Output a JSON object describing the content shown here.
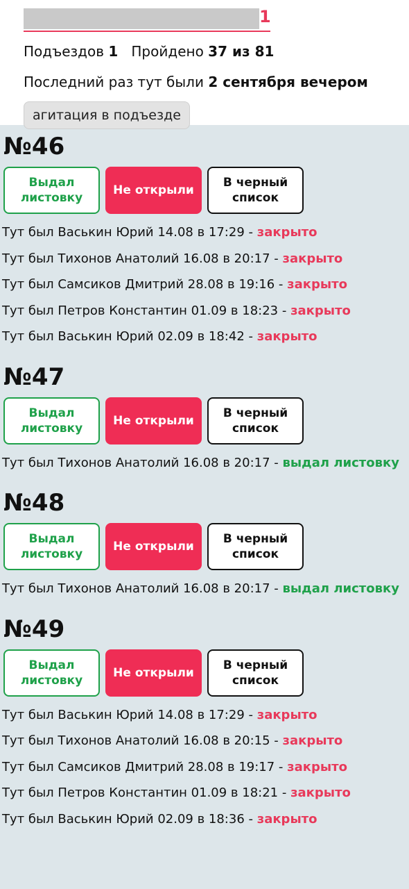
{
  "header": {
    "address_number": "1",
    "entrances_label": "Подъездов",
    "entrances_value": "1",
    "passed_label": "Пройдено",
    "passed_value": "37 из 81",
    "last_visit_label": "Последний раз тут были",
    "last_visit_value": "2 сентября вечером",
    "chip_label": "агитация в подъезде"
  },
  "buttons": {
    "leaflet": "Выдал листовку",
    "not_opened": "Не открыли",
    "blacklist": "В черный список"
  },
  "flats": [
    {
      "title": "№46",
      "visits": [
        {
          "text": "Тут был Васькин Юрий 14.08 в 17:29 -",
          "status": "закрыто",
          "type": "red"
        },
        {
          "text": "Тут был Тихонов Анатолий 16.08 в 20:17 -",
          "status": "закрыто",
          "type": "red"
        },
        {
          "text": "Тут был Самсиков Дмитрий 28.08 в 19:16 -",
          "status": "закрыто",
          "type": "red"
        },
        {
          "text": "Тут был Петров Константин 01.09 в 18:23 -",
          "status": "закрыто",
          "type": "red"
        },
        {
          "text": "Тут был Васькин Юрий 02.09 в 18:42 -",
          "status": "закрыто",
          "type": "red"
        }
      ]
    },
    {
      "title": "№47",
      "visits": [
        {
          "text": "Тут был Тихонов Анатолий 16.08 в 20:17 -",
          "status": "выдал листовку",
          "type": "green"
        }
      ]
    },
    {
      "title": "№48",
      "visits": [
        {
          "text": "Тут был Тихонов Анатолий 16.08 в 20:17 -",
          "status": "выдал листовку",
          "type": "green"
        }
      ]
    },
    {
      "title": "№49",
      "visits": [
        {
          "text": "Тут был Васькин Юрий 14.08 в 17:29 -",
          "status": "закрыто",
          "type": "red"
        },
        {
          "text": "Тут был Тихонов Анатолий 16.08 в 20:15 -",
          "status": "закрыто",
          "type": "red"
        },
        {
          "text": "Тут был Самсиков Дмитрий 28.08 в 19:17 -",
          "status": "закрыто",
          "type": "red"
        },
        {
          "text": "Тут был Петров Константин 01.09 в 18:21 -",
          "status": "закрыто",
          "type": "red"
        },
        {
          "text": "Тут был Васькин Юрий 02.09 в 18:36 -",
          "status": "закрыто",
          "type": "red"
        }
      ]
    }
  ]
}
